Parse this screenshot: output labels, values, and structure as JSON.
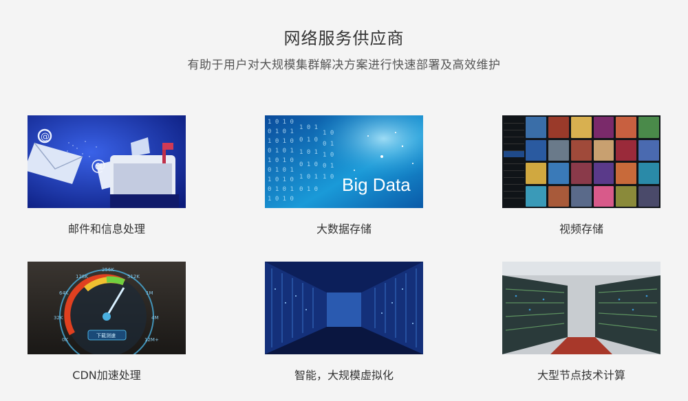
{
  "header": {
    "title": "网络服务供应商",
    "subtitle": "有助于用户对大规模集群解决方案进行快速部署及高效维护"
  },
  "cards": [
    {
      "caption": "邮件和信息处理",
      "image": "email-envelopes-image"
    },
    {
      "caption": "大数据存储",
      "image": "big-data-image",
      "overlay_text": "Big Data"
    },
    {
      "caption": "视频存储",
      "image": "video-library-image"
    },
    {
      "caption": "CDN加速处理",
      "image": "speedometer-image",
      "gauge_labels": [
        "0K",
        "32K",
        "64K",
        "128K",
        "256K",
        "512K",
        "1M",
        "4M",
        "12M+"
      ],
      "gauge_button": "下载测速"
    },
    {
      "caption": "智能，大规模虚拟化",
      "image": "server-corridor-image"
    },
    {
      "caption": "大型节点技术计算",
      "image": "server-racks-image"
    }
  ],
  "colors": {
    "background": "#f4f4f4",
    "text": "#333333",
    "accent_blue": "#1a78c2"
  }
}
